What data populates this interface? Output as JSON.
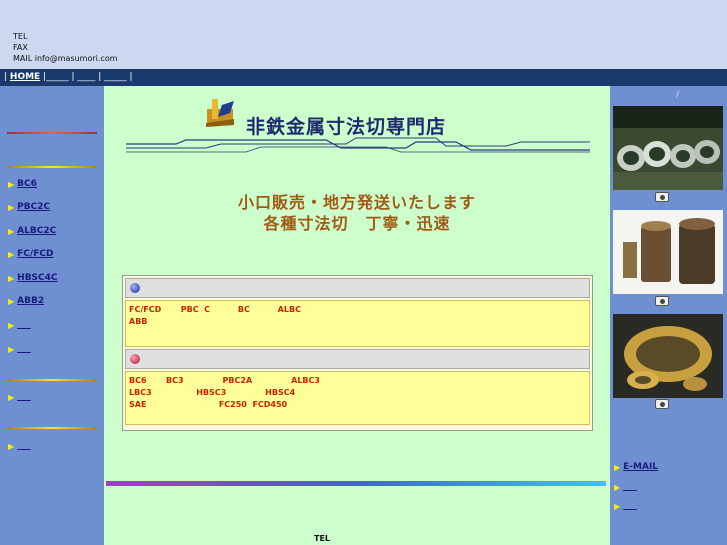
{
  "header": {
    "tel_label": "TEL",
    "fax_label": "FAX",
    "mail_line": "MAIL info@masumori.com"
  },
  "navbar": {
    "lead": "| ",
    "home": "HOME",
    "rest": " |_____ | ____ | _____ |"
  },
  "sidebar": {
    "items": [
      {
        "label": "BC6"
      },
      {
        "label": "PBC2C"
      },
      {
        "label": "ALBC2C"
      },
      {
        "label": "FC/FCD"
      },
      {
        "label": "HBSC4C"
      },
      {
        "label": "ABB2"
      },
      {
        "label": "___"
      },
      {
        "label": "___"
      },
      {
        "label": "___"
      },
      {
        "label": "___"
      }
    ]
  },
  "main": {
    "shop_title": "非鉄金属寸法切専門店",
    "tagline_1": "小口販売・地方発送いたします",
    "tagline_2": "各種寸法切　丁寧・迅速",
    "section_1": {
      "lines": [
        "FC/FCD       PBC  C          BC          ALBC",
        "ABB"
      ]
    },
    "section_2": {
      "lines": [
        "BC6       BC3              PBC2A              ALBC3",
        "LBC3                HBSC3              HBSC4",
        "SAE                          FC250  FCD450"
      ]
    },
    "footer_tel": "TEL"
  },
  "rightbar": {
    "slash": "/",
    "links": [
      {
        "label": "E-MAIL"
      },
      {
        "label": "___"
      },
      {
        "label": "___"
      }
    ]
  },
  "colors": {
    "top_bar": "#ccd8f0",
    "nav_bar": "#1a3a6e",
    "side_column": "#6e8fd0",
    "center_bg": "#ccffcc",
    "product_text": "#cc2200",
    "tagline": "#a05a14"
  }
}
